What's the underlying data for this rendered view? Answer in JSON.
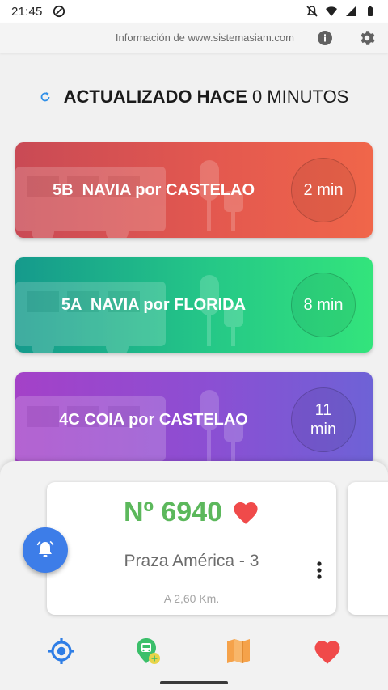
{
  "status_bar": {
    "time": "21:45"
  },
  "info_bar": {
    "text": "Información de www.sistemasiam.com"
  },
  "updated": {
    "label": "ACTUALIZADO HACE",
    "value": "0 MINUTOS"
  },
  "routes": [
    {
      "label": "5B  NAVIA por CASTELAO",
      "eta": "2 min",
      "color": "#e3584f"
    },
    {
      "label": "5A  NAVIA por FLORIDA",
      "eta": "8 min",
      "color": "#25c887"
    },
    {
      "label": "4C COIA por CASTELAO",
      "eta_line1": "11",
      "eta_line2": "min",
      "color": "#8b4fd3"
    }
  ],
  "stop": {
    "number": "Nº 6940",
    "name": "Praza América - 3",
    "distance": "A 2,60 Km."
  },
  "colors": {
    "stop_number": "#5cb85c",
    "heart": "#f04a4a",
    "fab": "#3d7de8",
    "nav_gps": "#2f7ee6",
    "nav_map": "#f5a24a"
  },
  "icons": {
    "info": "info-icon",
    "settings": "gear-icon",
    "refresh": "refresh-icon",
    "favorite": "heart-icon",
    "more": "more-vert-icon",
    "alarm": "bell-icon",
    "nav": [
      "gps-icon",
      "bus-stop-icon",
      "map-icon",
      "heart-icon"
    ]
  }
}
